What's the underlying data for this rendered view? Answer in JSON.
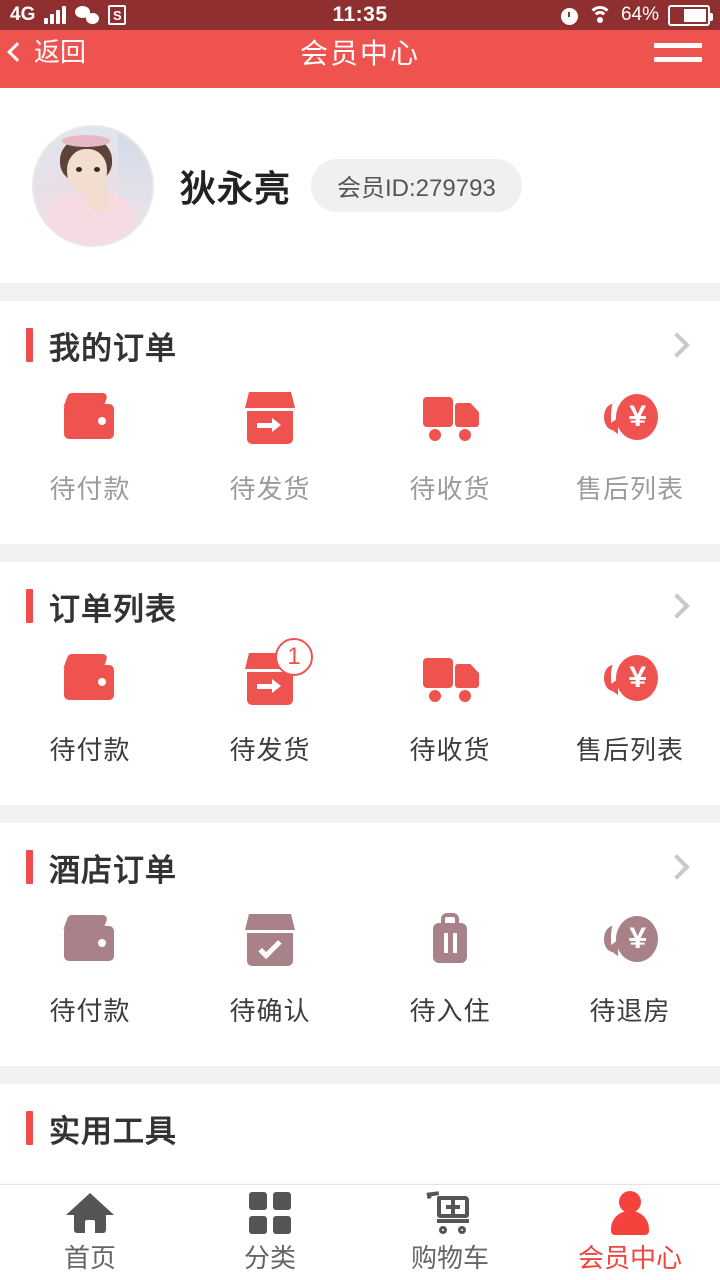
{
  "statusbar": {
    "network": "4G",
    "time": "11:35",
    "battery_percent": "64%",
    "icons": [
      "signal-bars-icon",
      "wechat-icon",
      "app-s-icon",
      "alarm-icon",
      "wifi-icon",
      "battery-icon"
    ]
  },
  "nav": {
    "back_label": "返回",
    "title": "会员中心",
    "menu_icon": "hamburger-menu-icon"
  },
  "profile": {
    "name": "狄永亮",
    "member_id": "会员ID:279793",
    "avatar_icon": "user-photo-avatar"
  },
  "sections": [
    {
      "title": "我的订单",
      "label_style": "gray",
      "items": [
        {
          "label": "待付款",
          "icon": "wallet-icon",
          "badge": ""
        },
        {
          "label": "待发货",
          "icon": "box-arrow-icon",
          "badge": ""
        },
        {
          "label": "待收货",
          "icon": "truck-icon",
          "badge": ""
        },
        {
          "label": "售后列表",
          "icon": "yen-refund-icon",
          "badge": ""
        }
      ]
    },
    {
      "title": "订单列表",
      "label_style": "dark",
      "items": [
        {
          "label": "待付款",
          "icon": "wallet-icon",
          "badge": ""
        },
        {
          "label": "待发货",
          "icon": "box-arrow-icon",
          "badge": "1"
        },
        {
          "label": "待收货",
          "icon": "truck-icon",
          "badge": ""
        },
        {
          "label": "售后列表",
          "icon": "yen-refund-icon",
          "badge": ""
        }
      ]
    },
    {
      "title": "酒店订单",
      "label_style": "dark",
      "items": [
        {
          "label": "待付款",
          "icon": "wallet-icon",
          "badge": ""
        },
        {
          "label": "待确认",
          "icon": "box-check-icon",
          "badge": ""
        },
        {
          "label": "待入住",
          "icon": "suitcase-icon",
          "badge": ""
        },
        {
          "label": "待退房",
          "icon": "yen-refund-icon",
          "badge": ""
        }
      ]
    },
    {
      "title": "实用工具",
      "label_style": "dark",
      "items": [
        {
          "label": "",
          "icon": "star-tool-icon",
          "badge": ""
        },
        {
          "label": "",
          "icon": "paw-tool-icon",
          "badge": ""
        },
        {
          "label": "",
          "icon": "location-pin-tool-icon",
          "badge": ""
        },
        {
          "label": "",
          "icon": "drop-tool-icon",
          "badge": ""
        }
      ]
    }
  ],
  "tabbar": {
    "tabs": [
      {
        "label": "首页",
        "icon": "home-icon",
        "active": false
      },
      {
        "label": "分类",
        "icon": "grid-icon",
        "active": false
      },
      {
        "label": "购物车",
        "icon": "cart-plus-icon",
        "active": false
      },
      {
        "label": "会员中心",
        "icon": "user-icon",
        "active": true
      }
    ]
  },
  "colors": {
    "header_red": "#ef5350",
    "statusbar_red": "#8f2f2f",
    "accent_red": "#ef4d4d",
    "tab_active": "#f4433c",
    "icon_red": "#ef5350",
    "icon_muted": "#a98189",
    "page_bg": "#f2f2f2"
  }
}
